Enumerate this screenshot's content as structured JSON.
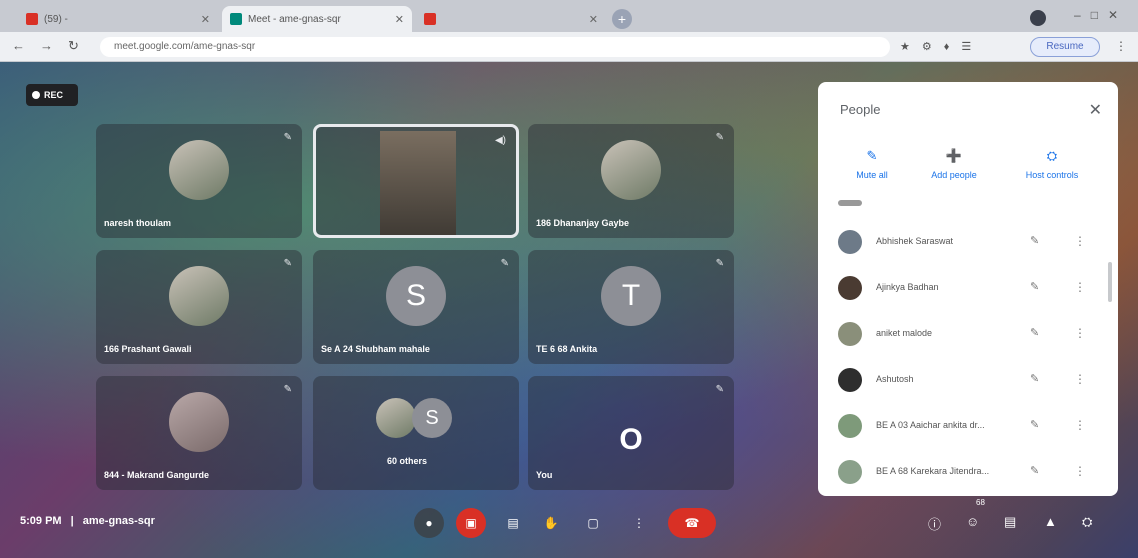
{
  "browser": {
    "tabs": [
      {
        "title": "(59) - ",
        "fav": "#d93025"
      },
      {
        "title": "Meet - ame-gnas-sqr",
        "fav": "#00897b"
      },
      {
        "title": "",
        "fav": "#d93025"
      }
    ],
    "url": "meet.google.com/ame-gnas-sqr",
    "resume_label": "Resume"
  },
  "meeting": {
    "rec_label": "REC",
    "time": "5:09 PM",
    "separator": "|",
    "code": "ame-gnas-sqr",
    "participant_count_badge": "68"
  },
  "tiles": [
    {
      "name": "naresh thoulam",
      "kind": "avatar"
    },
    {
      "name": "",
      "kind": "video"
    },
    {
      "name": "186 Dhananjay Gaybe",
      "kind": "avatar"
    },
    {
      "name": "166 Prashant Gawali",
      "kind": "avatar"
    },
    {
      "name": "Se A 24 Shubham mahale",
      "kind": "letter",
      "letter": "S",
      "color": "#8d8f96"
    },
    {
      "name": "TE 6 68 Ankita",
      "kind": "letter",
      "letter": "T",
      "color": "#8d8f96"
    },
    {
      "name": "844 - Makrand Gangurde",
      "kind": "avatar"
    },
    {
      "name": "60 others",
      "kind": "others",
      "letter": "S"
    },
    {
      "name": "You",
      "kind": "plain",
      "letter": "O"
    }
  ],
  "people_panel": {
    "title": "People",
    "actions": [
      {
        "label": "Mute all",
        "icon": "mic-off-icon",
        "glyph": "✎"
      },
      {
        "label": "Add people",
        "icon": "add-person-icon",
        "glyph": "➕"
      },
      {
        "label": "Host controls",
        "icon": "host-controls-icon",
        "glyph": "⛭"
      }
    ],
    "participants": [
      {
        "name": "Abhishek Saraswat"
      },
      {
        "name": "Ajinkya Badhan"
      },
      {
        "name": "aniket malode"
      },
      {
        "name": "Ashutosh"
      },
      {
        "name": "BE A 03 Aaichar ankita dr..."
      },
      {
        "name": "BE A 68 Karekara Jitendra..."
      }
    ]
  },
  "controls": {
    "bottom_center": [
      {
        "name": "mic-button",
        "glyph": "●"
      },
      {
        "name": "camera-button",
        "glyph": "▣"
      },
      {
        "name": "captions-button",
        "glyph": "▤"
      },
      {
        "name": "raise-hand-button",
        "glyph": "✋"
      },
      {
        "name": "present-button",
        "glyph": "▢"
      },
      {
        "name": "more-options-button",
        "glyph": "⋮"
      }
    ],
    "bottom_right": [
      {
        "name": "meeting-details-icon",
        "glyph": "ⓘ"
      },
      {
        "name": "people-icon",
        "glyph": "☺"
      },
      {
        "name": "chat-icon",
        "glyph": "▤"
      },
      {
        "name": "activities-icon",
        "glyph": "▲"
      },
      {
        "name": "host-controls-icon",
        "glyph": "⛭"
      }
    ]
  }
}
